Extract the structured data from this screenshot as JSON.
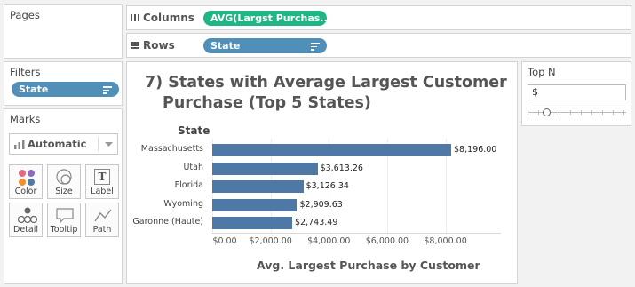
{
  "pages": {
    "title": "Pages"
  },
  "columns": {
    "label": "Columns",
    "pill": "AVG(Largst Purchas...)"
  },
  "rows": {
    "label": "Rows",
    "pill": "State"
  },
  "filters": {
    "title": "Filters",
    "pill": "State"
  },
  "marks": {
    "title": "Marks",
    "type": "Automatic",
    "buttons": [
      "Color",
      "Size",
      "Label",
      "Detail",
      "Tooltip",
      "Path"
    ],
    "label_glyph": "T"
  },
  "top_n": {
    "title": "Top N",
    "value": "$",
    "slider_level": 0.15
  },
  "colors": {
    "bar": "#4e79a7",
    "columns_pill": "#1fb585",
    "rows_pill": "#4f8fb8"
  },
  "chart_data": {
    "type": "bar",
    "orientation": "horizontal",
    "title_line1": "7) States with Average Largest Customer",
    "title_line2": "Purchase (Top 5 States)",
    "ylabel": "State",
    "xlabel": "Avg. Largest Purchase by Customer",
    "categories": [
      "Massachusetts",
      "Utah",
      "Florida",
      "Wyoming",
      "Garonne (Haute)"
    ],
    "values": [
      8196.0,
      3613.26,
      3126.34,
      2909.63,
      2743.49
    ],
    "value_labels": [
      "$8,196.00",
      "$3,613.26",
      "$3,126.34",
      "$2,909.63",
      "$2,743.49"
    ],
    "xticks": [
      0,
      2000,
      4000,
      6000,
      8000
    ],
    "xtick_labels": [
      "$0.00",
      "$2,000.00",
      "$4,000.00",
      "$6,000.00",
      "$8,000.00"
    ],
    "xlim": [
      0,
      8196
    ],
    "grid": true
  }
}
